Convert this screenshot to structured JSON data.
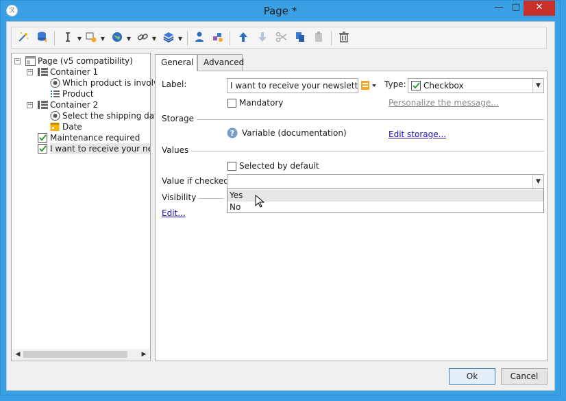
{
  "window": {
    "title": "Page *",
    "minimize": "—",
    "maximize": "□",
    "close": "✕",
    "app_icon": "ℛ"
  },
  "toolbar": {
    "items": [
      {
        "icon": "magic-wand-icon"
      },
      {
        "icon": "database-icon"
      },
      {
        "icon": "text-cursor-icon"
      },
      {
        "icon": "form-field-icon"
      },
      {
        "icon": "globe-icon"
      },
      {
        "icon": "link-icon"
      },
      {
        "icon": "container-icon"
      },
      {
        "icon": "person-icon"
      },
      {
        "icon": "shapes-icon"
      },
      {
        "icon": "move-up-icon"
      },
      {
        "icon": "move-down-icon"
      },
      {
        "icon": "cut-icon"
      },
      {
        "icon": "copy-icon"
      },
      {
        "icon": "paste-icon"
      },
      {
        "icon": "trash-icon"
      }
    ]
  },
  "tree": {
    "items": [
      {
        "label": "Page (v5 compatibility)",
        "icon": "page-icon"
      },
      {
        "label": "Container 1",
        "icon": "container-icon"
      },
      {
        "label": "Which product is involve",
        "icon": "radio-icon"
      },
      {
        "label": "Product",
        "icon": "list-icon"
      },
      {
        "label": "Container 2",
        "icon": "container-icon"
      },
      {
        "label": "Select the shipping date",
        "icon": "radio-icon"
      },
      {
        "label": "Date",
        "icon": "date-icon"
      },
      {
        "label": "Maintenance required",
        "icon": "checkbox-icon"
      },
      {
        "label": "I want to receive your newsl",
        "icon": "checkbox-icon"
      }
    ]
  },
  "tabs": {
    "general": "General",
    "advanced": "Advanced"
  },
  "form": {
    "label_caption": "Label:",
    "label_value": "I want to receive your newsletter",
    "type_caption": "Type:",
    "type_value": "Checkbox",
    "mandatory": "Mandatory",
    "personalize_link": "Personalize the message...",
    "storage_heading": "Storage",
    "storage_variable": "Variable (documentation)",
    "edit_storage_link": "Edit storage...",
    "values_heading": "Values",
    "selected_by_default": "Selected by default",
    "value_if_checked_caption": "Value if checked:",
    "value_if_checked_value": "",
    "visibility_heading": "Visibility",
    "edit_link": "Edit...",
    "dropdown_options": [
      "Yes",
      "No"
    ]
  },
  "buttons": {
    "ok": "Ok",
    "cancel": "Cancel"
  },
  "colors": {
    "window_frame": "#3aa0e4",
    "close_button": "#c7312a",
    "link": "#1a0dab"
  }
}
